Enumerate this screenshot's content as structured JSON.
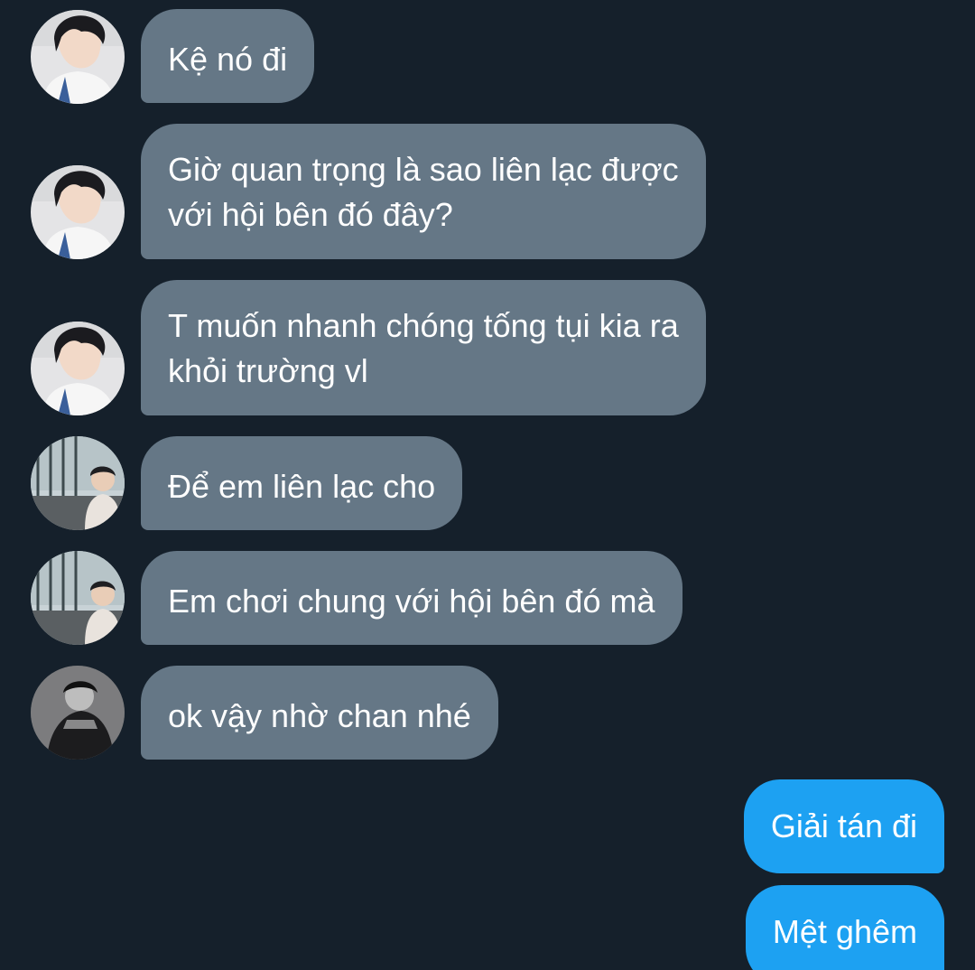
{
  "colors": {
    "background": "#15202b",
    "received_bubble": "#657786",
    "sent_bubble": "#1da1f2",
    "text": "#ffffff"
  },
  "messages": [
    {
      "direction": "received",
      "sender_avatar": "avatar-a",
      "lines": [
        "Kệ nó đi"
      ]
    },
    {
      "direction": "received",
      "sender_avatar": "avatar-a",
      "lines": [
        "Giờ quan trọng là sao liên lạc được",
        "với hội bên đó đây?"
      ]
    },
    {
      "direction": "received",
      "sender_avatar": "avatar-a",
      "lines": [
        "T muốn nhanh chóng tống tụi kia ra",
        "khỏi trường vl"
      ]
    },
    {
      "direction": "received",
      "sender_avatar": "avatar-b",
      "lines": [
        "Để em liên lạc cho"
      ]
    },
    {
      "direction": "received",
      "sender_avatar": "avatar-b",
      "lines": [
        "Em chơi chung với hội bên đó mà"
      ]
    },
    {
      "direction": "received",
      "sender_avatar": "avatar-c",
      "lines": [
        "ok vậy nhờ chan nhé"
      ]
    },
    {
      "direction": "sent",
      "lines": [
        "Giải tán đi"
      ]
    },
    {
      "direction": "sent",
      "lines": [
        "Mệt ghêm"
      ]
    }
  ]
}
